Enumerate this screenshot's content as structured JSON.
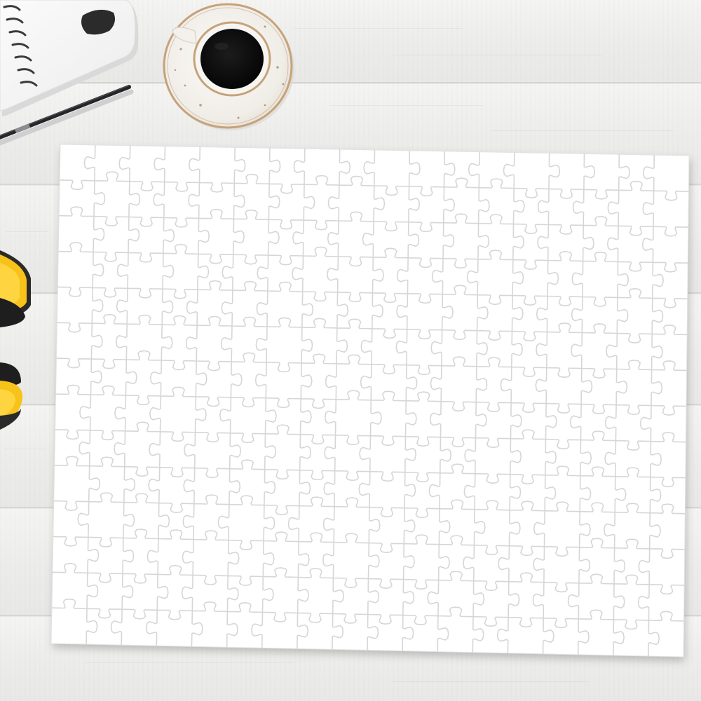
{
  "scene": {
    "subject": "blank-jigsaw-puzzle",
    "puzzle": {
      "columns": 18,
      "rows": 14,
      "piece_color": "#ffffff",
      "cut_line_color": "#d6d6d6"
    },
    "background": {
      "surface": "white-wood-planks",
      "plank_color": "#efefed",
      "seam_color": "#cfcfcd"
    },
    "props": [
      {
        "name": "spiral-notebook",
        "color": "#f7f7f7"
      },
      {
        "name": "ballpoint-pen",
        "color": "#2a2a2e"
      },
      {
        "name": "coffee-cup",
        "color": "#f2efea",
        "accent": "#c6a27a"
      },
      {
        "name": "yellow-headphones",
        "color": "#f7c21a",
        "accent": "#222222"
      }
    ]
  }
}
